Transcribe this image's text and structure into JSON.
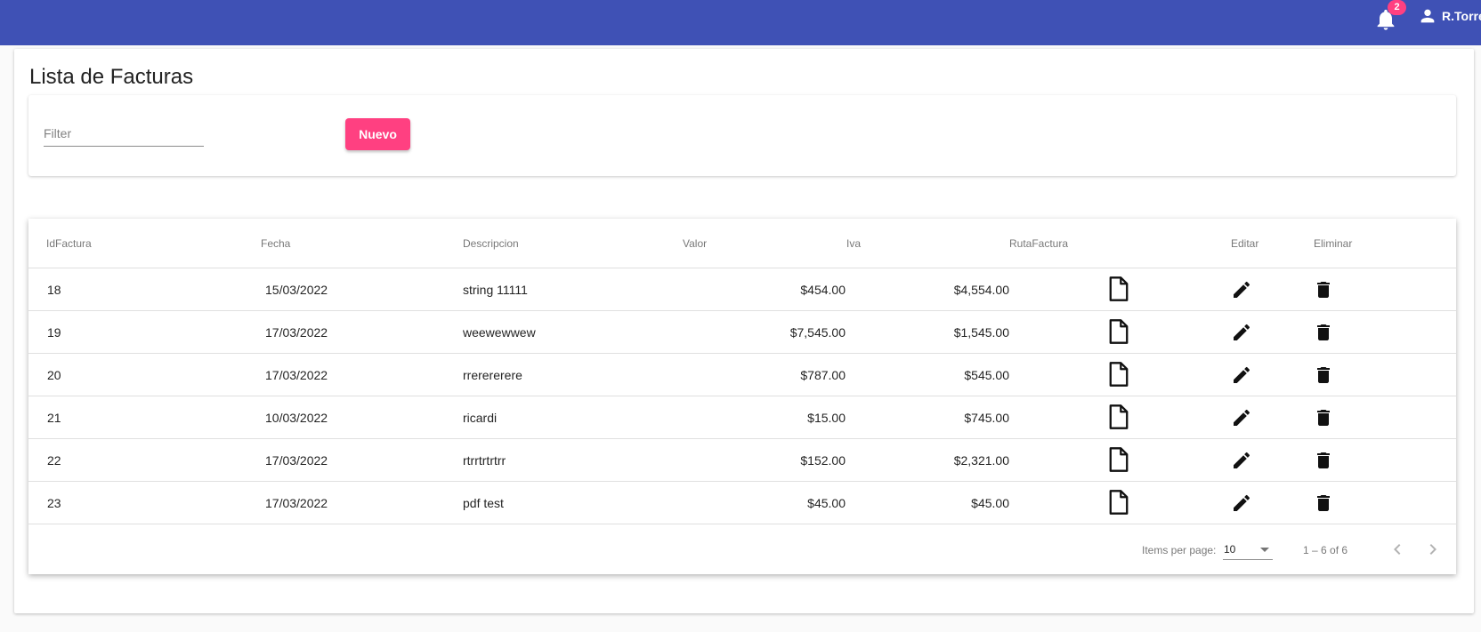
{
  "header": {
    "notification_count": "2",
    "user_name": "R.Torre"
  },
  "page": {
    "title": "Lista de Facturas"
  },
  "toolbar": {
    "filter_placeholder": "Filter",
    "new_label": "Nuevo"
  },
  "table": {
    "columns": {
      "id": "IdFactura",
      "fecha": "Fecha",
      "descripcion": "Descripcion",
      "valor": "Valor",
      "iva": "Iva",
      "ruta": "RutaFactura",
      "editar": "Editar",
      "eliminar": "Eliminar"
    },
    "rows": [
      {
        "id": "18",
        "fecha": "15/03/2022",
        "descripcion": "string 11111",
        "valor": "$454.00",
        "iva": "$4,554.00"
      },
      {
        "id": "19",
        "fecha": "17/03/2022",
        "descripcion": "weewewwew",
        "valor": "$7,545.00",
        "iva": "$1,545.00"
      },
      {
        "id": "20",
        "fecha": "17/03/2022",
        "descripcion": "rrerererere",
        "valor": "$787.00",
        "iva": "$545.00"
      },
      {
        "id": "21",
        "fecha": "10/03/2022",
        "descripcion": "ricardi",
        "valor": "$15.00",
        "iva": "$745.00"
      },
      {
        "id": "22",
        "fecha": "17/03/2022",
        "descripcion": "rtrrtrtrtrr",
        "valor": "$152.00",
        "iva": "$2,321.00"
      },
      {
        "id": "23",
        "fecha": "17/03/2022",
        "descripcion": "pdf test",
        "valor": "$45.00",
        "iva": "$45.00"
      }
    ]
  },
  "paginator": {
    "items_per_page_label": "Items per page:",
    "page_size": "10",
    "range_label": "1 – 6 of 6"
  },
  "icons": {
    "notifications": "bell-icon",
    "user": "person-icon",
    "file": "file-icon",
    "edit": "pencil-icon",
    "delete": "trash-icon",
    "previous": "chevron-left-icon",
    "next": "chevron-right-icon"
  },
  "colors": {
    "primary": "#3f51b5",
    "accent": "#ff4081"
  }
}
